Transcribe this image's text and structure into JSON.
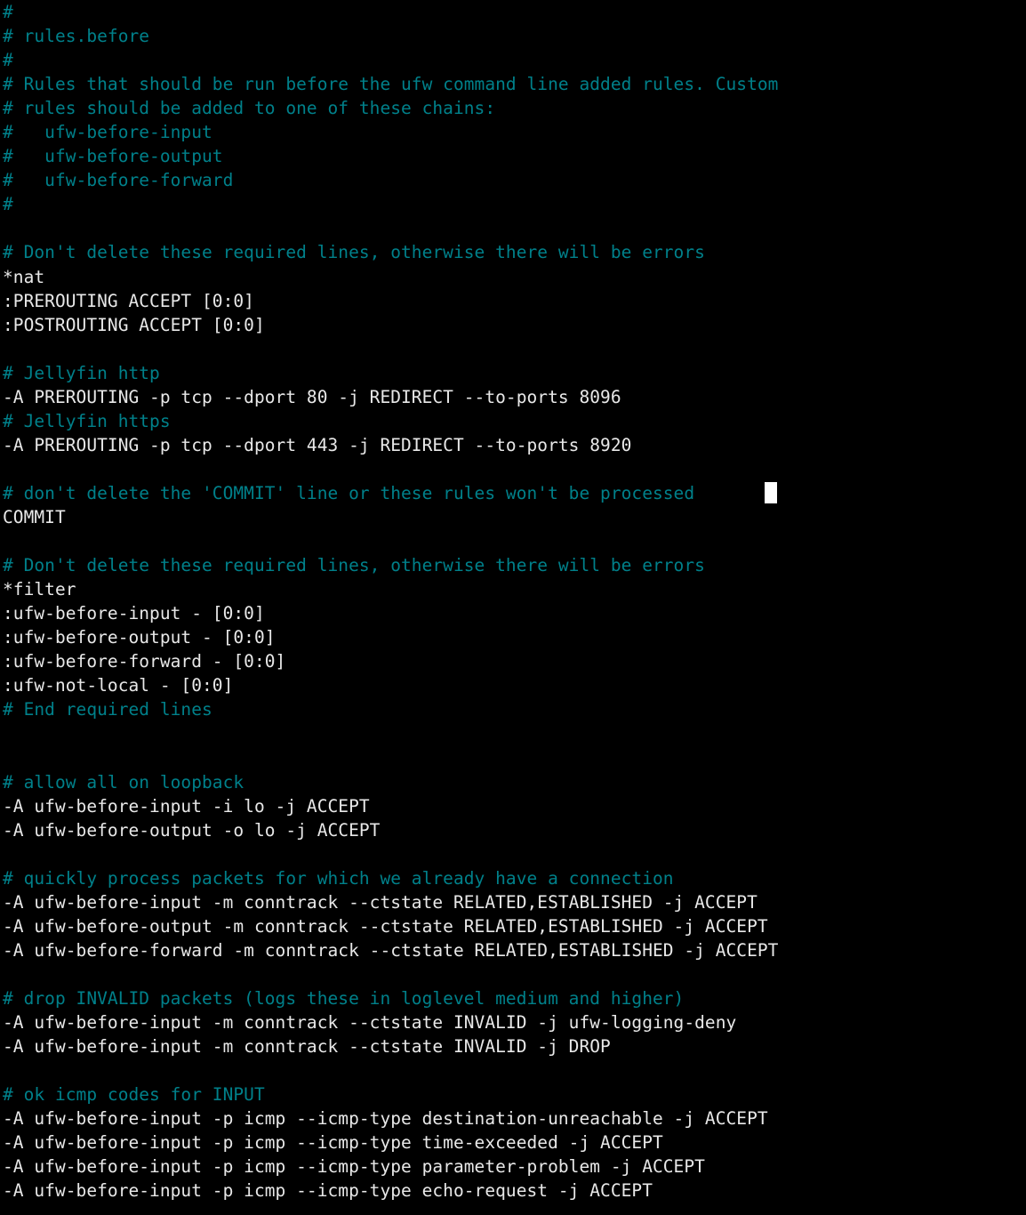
{
  "terminal": {
    "background_color": "#000000",
    "comment_color": "#00808a",
    "code_color": "#e8e8e8",
    "cursor_color": "#ffffff",
    "cursor_line_index": 20,
    "cursor_column": 73
  },
  "file": {
    "name": "rules.before",
    "lines": [
      {
        "i": 0,
        "type": "comment",
        "text": "#"
      },
      {
        "i": 1,
        "type": "comment",
        "text": "# rules.before"
      },
      {
        "i": 2,
        "type": "comment",
        "text": "#"
      },
      {
        "i": 3,
        "type": "comment",
        "text": "# Rules that should be run before the ufw command line added rules. Custom"
      },
      {
        "i": 4,
        "type": "comment",
        "text": "# rules should be added to one of these chains:"
      },
      {
        "i": 5,
        "type": "comment",
        "text": "#   ufw-before-input"
      },
      {
        "i": 6,
        "type": "comment",
        "text": "#   ufw-before-output"
      },
      {
        "i": 7,
        "type": "comment",
        "text": "#   ufw-before-forward"
      },
      {
        "i": 8,
        "type": "comment",
        "text": "#"
      },
      {
        "i": 9,
        "type": "blank",
        "text": ""
      },
      {
        "i": 10,
        "type": "comment",
        "text": "# Don't delete these required lines, otherwise there will be errors"
      },
      {
        "i": 11,
        "type": "code",
        "text": "*nat"
      },
      {
        "i": 12,
        "type": "code",
        "text": ":PREROUTING ACCEPT [0:0]"
      },
      {
        "i": 13,
        "type": "code",
        "text": ":POSTROUTING ACCEPT [0:0]"
      },
      {
        "i": 14,
        "type": "blank",
        "text": ""
      },
      {
        "i": 15,
        "type": "comment",
        "text": "# Jellyfin http"
      },
      {
        "i": 16,
        "type": "code",
        "text": "-A PREROUTING -p tcp --dport 80 -j REDIRECT --to-ports 8096"
      },
      {
        "i": 17,
        "type": "comment",
        "text": "# Jellyfin https"
      },
      {
        "i": 18,
        "type": "code",
        "text": "-A PREROUTING -p tcp --dport 443 -j REDIRECT --to-ports 8920"
      },
      {
        "i": 19,
        "type": "blank",
        "text": ""
      },
      {
        "i": 20,
        "type": "comment",
        "text": "# don't delete the 'COMMIT' line or these rules won't be processed"
      },
      {
        "i": 21,
        "type": "code",
        "text": "COMMIT"
      },
      {
        "i": 22,
        "type": "blank",
        "text": ""
      },
      {
        "i": 23,
        "type": "comment",
        "text": "# Don't delete these required lines, otherwise there will be errors"
      },
      {
        "i": 24,
        "type": "code",
        "text": "*filter"
      },
      {
        "i": 25,
        "type": "code",
        "text": ":ufw-before-input - [0:0]"
      },
      {
        "i": 26,
        "type": "code",
        "text": ":ufw-before-output - [0:0]"
      },
      {
        "i": 27,
        "type": "code",
        "text": ":ufw-before-forward - [0:0]"
      },
      {
        "i": 28,
        "type": "code",
        "text": ":ufw-not-local - [0:0]"
      },
      {
        "i": 29,
        "type": "comment",
        "text": "# End required lines"
      },
      {
        "i": 30,
        "type": "blank",
        "text": ""
      },
      {
        "i": 31,
        "type": "blank",
        "text": ""
      },
      {
        "i": 32,
        "type": "comment",
        "text": "# allow all on loopback"
      },
      {
        "i": 33,
        "type": "code",
        "text": "-A ufw-before-input -i lo -j ACCEPT"
      },
      {
        "i": 34,
        "type": "code",
        "text": "-A ufw-before-output -o lo -j ACCEPT"
      },
      {
        "i": 35,
        "type": "blank",
        "text": ""
      },
      {
        "i": 36,
        "type": "comment",
        "text": "# quickly process packets for which we already have a connection"
      },
      {
        "i": 37,
        "type": "code",
        "text": "-A ufw-before-input -m conntrack --ctstate RELATED,ESTABLISHED -j ACCEPT"
      },
      {
        "i": 38,
        "type": "code",
        "text": "-A ufw-before-output -m conntrack --ctstate RELATED,ESTABLISHED -j ACCEPT"
      },
      {
        "i": 39,
        "type": "code",
        "text": "-A ufw-before-forward -m conntrack --ctstate RELATED,ESTABLISHED -j ACCEPT"
      },
      {
        "i": 40,
        "type": "blank",
        "text": ""
      },
      {
        "i": 41,
        "type": "comment",
        "text": "# drop INVALID packets (logs these in loglevel medium and higher)"
      },
      {
        "i": 42,
        "type": "code",
        "text": "-A ufw-before-input -m conntrack --ctstate INVALID -j ufw-logging-deny"
      },
      {
        "i": 43,
        "type": "code",
        "text": "-A ufw-before-input -m conntrack --ctstate INVALID -j DROP"
      },
      {
        "i": 44,
        "type": "blank",
        "text": ""
      },
      {
        "i": 45,
        "type": "comment",
        "text": "# ok icmp codes for INPUT"
      },
      {
        "i": 46,
        "type": "code",
        "text": "-A ufw-before-input -p icmp --icmp-type destination-unreachable -j ACCEPT"
      },
      {
        "i": 47,
        "type": "code",
        "text": "-A ufw-before-input -p icmp --icmp-type time-exceeded -j ACCEPT"
      },
      {
        "i": 48,
        "type": "code",
        "text": "-A ufw-before-input -p icmp --icmp-type parameter-problem -j ACCEPT"
      },
      {
        "i": 49,
        "type": "code",
        "text": "-A ufw-before-input -p icmp --icmp-type echo-request -j ACCEPT"
      }
    ]
  }
}
